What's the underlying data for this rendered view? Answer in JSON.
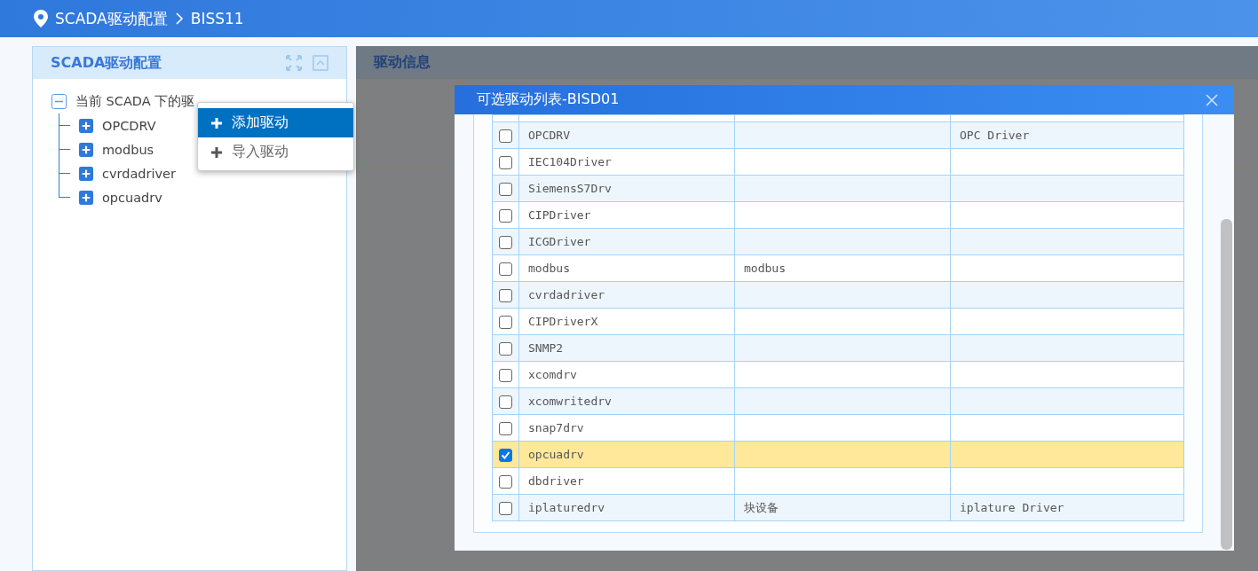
{
  "breadcrumb": [
    "SCADA驱动配置",
    "BISS11"
  ],
  "left_panel": {
    "title": "SCADA驱动配置",
    "tree": {
      "label": "当前 SCADA 下的驱",
      "expanded": true,
      "children": [
        {
          "label": "OPCDRV",
          "expanded": false
        },
        {
          "label": "modbus",
          "expanded": false
        },
        {
          "label": "cvrdadriver",
          "expanded": false
        },
        {
          "label": "opcuadrv",
          "expanded": false
        }
      ]
    }
  },
  "context_menu": [
    {
      "label": "添加驱动",
      "selected": true
    },
    {
      "label": "导入驱动",
      "selected": false
    }
  ],
  "right_panel": {
    "title": "驱动信息"
  },
  "dialog": {
    "title": "可选驱动列表-BISD01",
    "rows": [
      {
        "checked": false,
        "name": "OPCDRV",
        "column_3": "",
        "column_4": "OPC Driver"
      },
      {
        "checked": false,
        "name": "IEC104Driver",
        "column_3": "",
        "column_4": ""
      },
      {
        "checked": false,
        "name": "SiemensS7Drv",
        "column_3": "",
        "column_4": ""
      },
      {
        "checked": false,
        "name": "CIPDriver",
        "column_3": "",
        "column_4": ""
      },
      {
        "checked": false,
        "name": "ICGDriver",
        "column_3": "",
        "column_4": ""
      },
      {
        "checked": false,
        "name": "modbus",
        "column_3": "modbus",
        "column_4": ""
      },
      {
        "checked": false,
        "name": "cvrdadriver",
        "column_3": "",
        "column_4": ""
      },
      {
        "checked": false,
        "name": "CIPDriverX",
        "column_3": "",
        "column_4": ""
      },
      {
        "checked": false,
        "name": "SNMP2",
        "column_3": "",
        "column_4": ""
      },
      {
        "checked": false,
        "name": "xcomdrv",
        "column_3": "",
        "column_4": ""
      },
      {
        "checked": false,
        "name": "xcomwritedrv",
        "column_3": "",
        "column_4": ""
      },
      {
        "checked": false,
        "name": "snap7drv",
        "column_3": "",
        "column_4": ""
      },
      {
        "checked": true,
        "name": "opcuadrv",
        "column_3": "",
        "column_4": ""
      },
      {
        "checked": false,
        "name": "dbdriver",
        "column_3": "",
        "column_4": ""
      },
      {
        "checked": false,
        "name": "iplaturedrv",
        "column_3": "块设备",
        "column_4": "iplature Driver"
      }
    ]
  }
}
